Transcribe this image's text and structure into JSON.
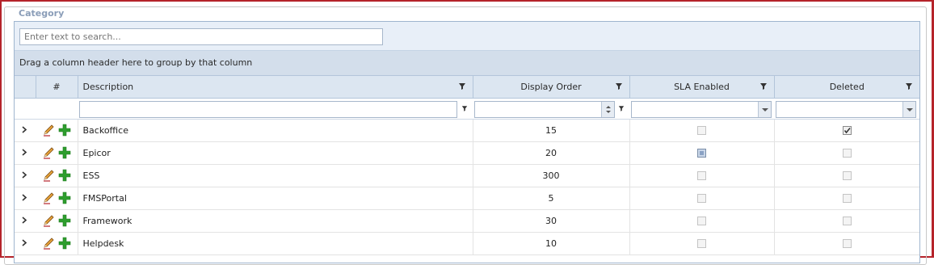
{
  "fieldset": {
    "legend": "Category"
  },
  "search": {
    "placeholder": "Enter text to search..."
  },
  "group_panel": {
    "text": "Drag a column header here to group by that column"
  },
  "columns": {
    "number": "#",
    "description": "Description",
    "display_order": "Display Order",
    "sla_enabled": "SLA Enabled",
    "deleted": "Deleted"
  },
  "rows": [
    {
      "description": "Backoffice",
      "display_order": "15",
      "sla_enabled": false,
      "deleted": true
    },
    {
      "description": "Epicor",
      "display_order": "20",
      "sla_enabled": "indeterminate",
      "deleted": false
    },
    {
      "description": "ESS",
      "display_order": "300",
      "sla_enabled": false,
      "deleted": false
    },
    {
      "description": "FMSPortal",
      "display_order": "5",
      "sla_enabled": false,
      "deleted": false
    },
    {
      "description": "Framework",
      "display_order": "30",
      "sla_enabled": false,
      "deleted": false
    },
    {
      "description": "Helpdesk",
      "display_order": "10",
      "sla_enabled": false,
      "deleted": false
    }
  ],
  "icons": {
    "expand": "chevron-right-icon",
    "edit": "pencil-icon",
    "add": "plus-icon",
    "filter": "filter-icon"
  },
  "colors": {
    "frame_border": "#b5232a",
    "header_bg": "#dce6f1",
    "group_panel_bg": "#d3deeb",
    "search_panel_bg": "#e8eff8",
    "add_icon": "#2e9e2e"
  }
}
